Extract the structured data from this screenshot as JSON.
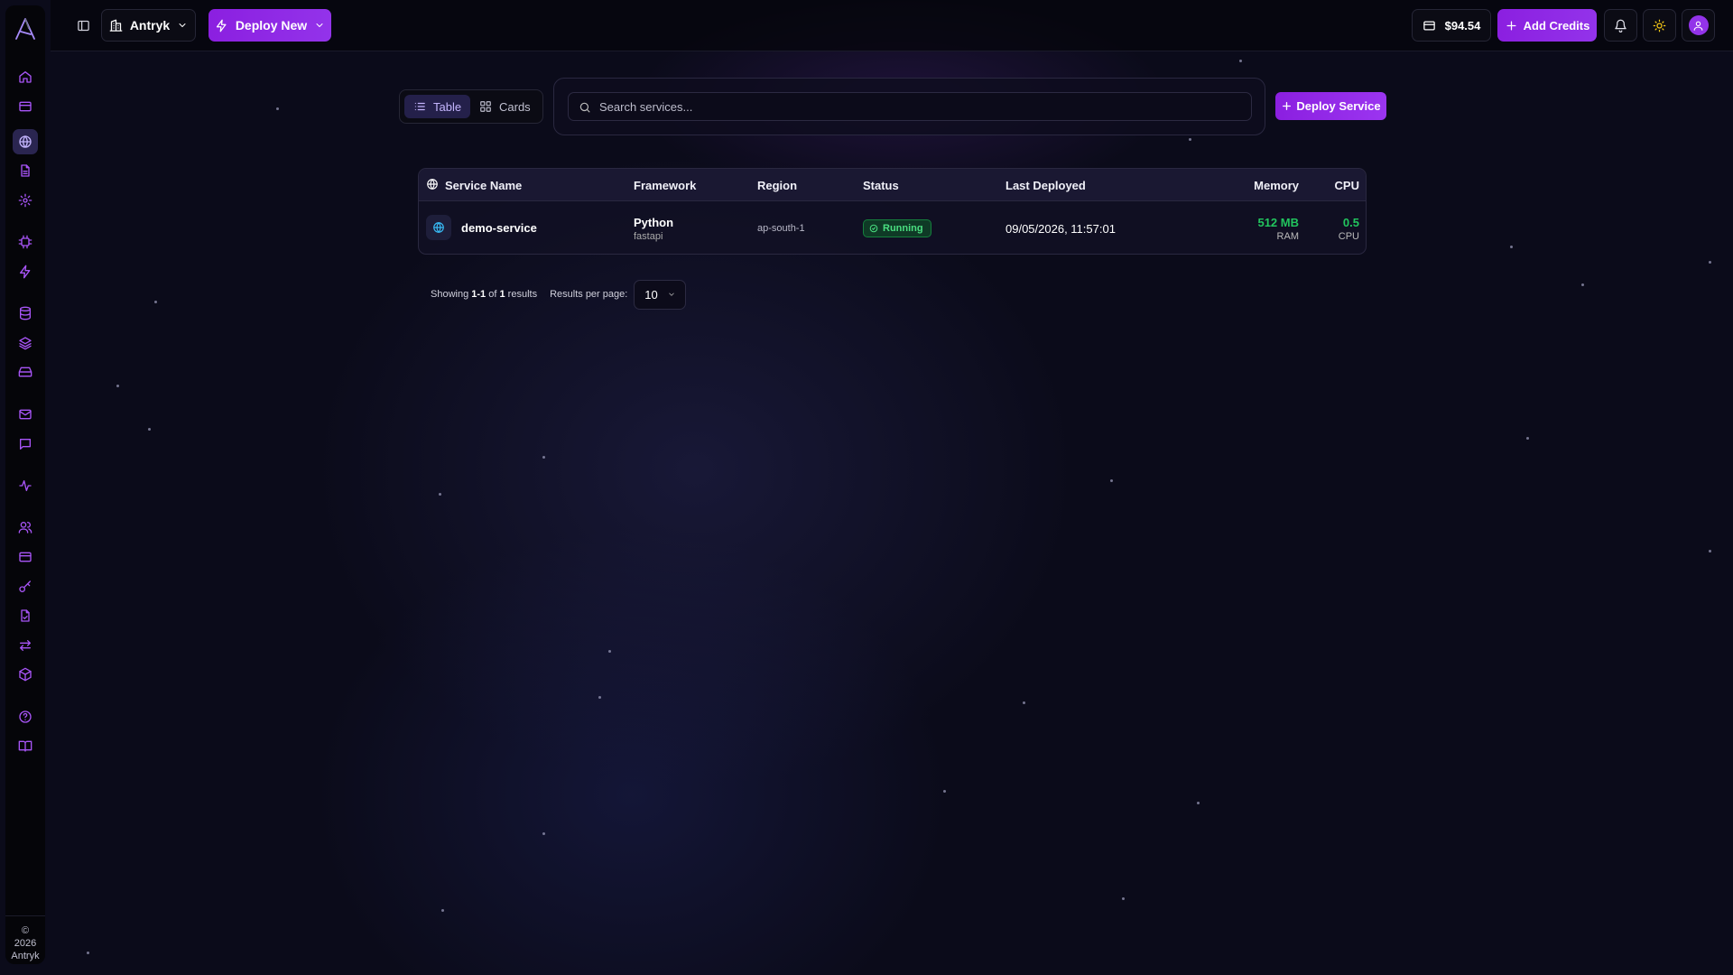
{
  "header": {
    "org_name": "Antryk",
    "deploy_new_label": "Deploy New",
    "balance": "$94.54",
    "add_credits_label": "Add Credits"
  },
  "sidebar": {
    "footer_symbol": "©",
    "footer_year": "2026",
    "footer_name": "Antryk",
    "items": [
      {
        "icon": "home-icon"
      },
      {
        "icon": "card-icon"
      },
      {
        "icon": "globe-icon",
        "active": true
      },
      {
        "icon": "file-icon"
      },
      {
        "icon": "gear-icon"
      },
      {
        "icon": "cpu-icon"
      },
      {
        "icon": "zap-icon"
      },
      {
        "icon": "database-icon"
      },
      {
        "icon": "layers-icon"
      },
      {
        "icon": "drive-icon"
      },
      {
        "icon": "mail-icon"
      },
      {
        "icon": "message-icon"
      },
      {
        "icon": "activity-icon"
      },
      {
        "icon": "users-icon"
      },
      {
        "icon": "billing-icon"
      },
      {
        "icon": "key-icon"
      },
      {
        "icon": "document-icon"
      },
      {
        "icon": "transfer-icon"
      },
      {
        "icon": "package-icon"
      },
      {
        "icon": "help-icon"
      },
      {
        "icon": "book-icon"
      }
    ]
  },
  "view_toggle": {
    "table_label": "Table",
    "cards_label": "Cards",
    "active": "table"
  },
  "search": {
    "placeholder": "Search services..."
  },
  "deploy_service_label": "Deploy Service",
  "table": {
    "headers": {
      "service_name": "Service Name",
      "framework": "Framework",
      "region": "Region",
      "status": "Status",
      "last_deployed": "Last Deployed",
      "memory": "Memory",
      "cpu": "CPU"
    },
    "rows": [
      {
        "name": "demo-service",
        "framework": "Python",
        "framework_sub": "fastapi",
        "region": "ap-south-1",
        "status": "Running",
        "last_deployed": "09/05/2026, 11:57:01",
        "memory": "512 MB",
        "memory_sub": "RAM",
        "cpu": "0.5",
        "cpu_sub": "CPU"
      }
    ]
  },
  "pagination": {
    "showing_prefix": "Showing",
    "range": "1-1",
    "of": "of",
    "total": "1",
    "results": "results",
    "per_page_label": "Results per page:",
    "per_page_value": "10"
  },
  "colors": {
    "accent": "#9333ea",
    "success": "#22c55e",
    "info": "#38bdf8"
  }
}
